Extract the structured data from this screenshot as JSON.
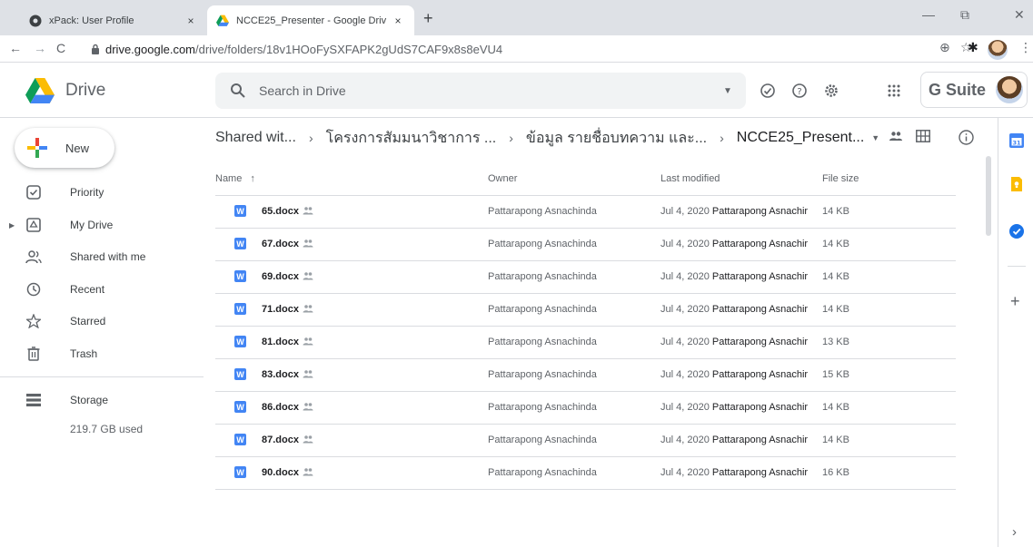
{
  "browser": {
    "tabs": [
      {
        "title": "xPack: User Profile",
        "close": "×"
      },
      {
        "title": "NCCE25_Presenter - Google Driv",
        "close": "×"
      }
    ],
    "new_tab": "+",
    "window_controls": {
      "minimize": "—",
      "restore": "⧉",
      "close": "✕"
    },
    "nav": {
      "back": "←",
      "forward": "→",
      "reload": "C"
    },
    "url_host": "drive.google.com",
    "url_path": "/drive/folders/18v1HOoFySXFAPK2gUdS7CAF9x8s8eVU4",
    "toolbar_icons": {
      "install": "⊕",
      "star": "☆",
      "extensions": "✱",
      "menu": "⋮"
    }
  },
  "drive": {
    "logo_text": "Drive",
    "search_placeholder": "Search in Drive",
    "search_options": "▼",
    "header_icons": {
      "offline": "⊘",
      "help": "?",
      "settings": "⚙",
      "apps": "⠿"
    },
    "gsuite_label": "G Suite"
  },
  "sidebar": {
    "new_label": "New",
    "items": [
      {
        "label": "Priority",
        "icon": "priority-icon"
      },
      {
        "label": "My Drive",
        "icon": "my-drive-icon"
      },
      {
        "label": "Shared with me",
        "icon": "shared-with-me-icon"
      },
      {
        "label": "Recent",
        "icon": "clock-icon"
      },
      {
        "label": "Starred",
        "icon": "star-icon"
      },
      {
        "label": "Trash",
        "icon": "trash-icon"
      }
    ],
    "storage_label": "Storage",
    "storage_used": "219.7 GB used"
  },
  "breadcrumb": {
    "items": [
      "Shared wit...",
      "โครงการสัมมนาวิชาการ ...",
      "ข้อมูล รายชื่อบทความ และ...",
      "NCCE25_Present..."
    ],
    "separator": "›",
    "dropdown": "▼"
  },
  "view_icons": {
    "people": "👥",
    "grid": "⊞",
    "info": "ⓘ"
  },
  "list": {
    "columns": {
      "name": "Name",
      "sort_arrow": "↑",
      "owner": "Owner",
      "modified": "Last modified",
      "size": "File size"
    },
    "rows": [
      {
        "name": "65.docx",
        "owner": "Pattarapong Asnachinda",
        "date": "Jul 4, 2020",
        "by": "Pattarapong Asnachir",
        "size": "14 KB"
      },
      {
        "name": "67.docx",
        "owner": "Pattarapong Asnachinda",
        "date": "Jul 4, 2020",
        "by": "Pattarapong Asnachir",
        "size": "14 KB"
      },
      {
        "name": "69.docx",
        "owner": "Pattarapong Asnachinda",
        "date": "Jul 4, 2020",
        "by": "Pattarapong Asnachir",
        "size": "14 KB"
      },
      {
        "name": "71.docx",
        "owner": "Pattarapong Asnachinda",
        "date": "Jul 4, 2020",
        "by": "Pattarapong Asnachir",
        "size": "14 KB"
      },
      {
        "name": "81.docx",
        "owner": "Pattarapong Asnachinda",
        "date": "Jul 4, 2020",
        "by": "Pattarapong Asnachir",
        "size": "13 KB"
      },
      {
        "name": "83.docx",
        "owner": "Pattarapong Asnachinda",
        "date": "Jul 4, 2020",
        "by": "Pattarapong Asnachir",
        "size": "15 KB"
      },
      {
        "name": "86.docx",
        "owner": "Pattarapong Asnachinda",
        "date": "Jul 4, 2020",
        "by": "Pattarapong Asnachir",
        "size": "14 KB"
      },
      {
        "name": "87.docx",
        "owner": "Pattarapong Asnachinda",
        "date": "Jul 4, 2020",
        "by": "Pattarapong Asnachir",
        "size": "14 KB"
      },
      {
        "name": "90.docx",
        "owner": "Pattarapong Asnachinda",
        "date": "Jul 4, 2020",
        "by": "Pattarapong Asnachir",
        "size": "16 KB"
      }
    ]
  },
  "side_panel": {
    "add": "+",
    "expand": "›"
  },
  "colors": {
    "accent_blue": "#1a73e8",
    "word_blue": "#4285f4",
    "calendar_blue": "#4285f4",
    "keep_yellow": "#fbbc04",
    "tasks_blue": "#1a73e8"
  }
}
